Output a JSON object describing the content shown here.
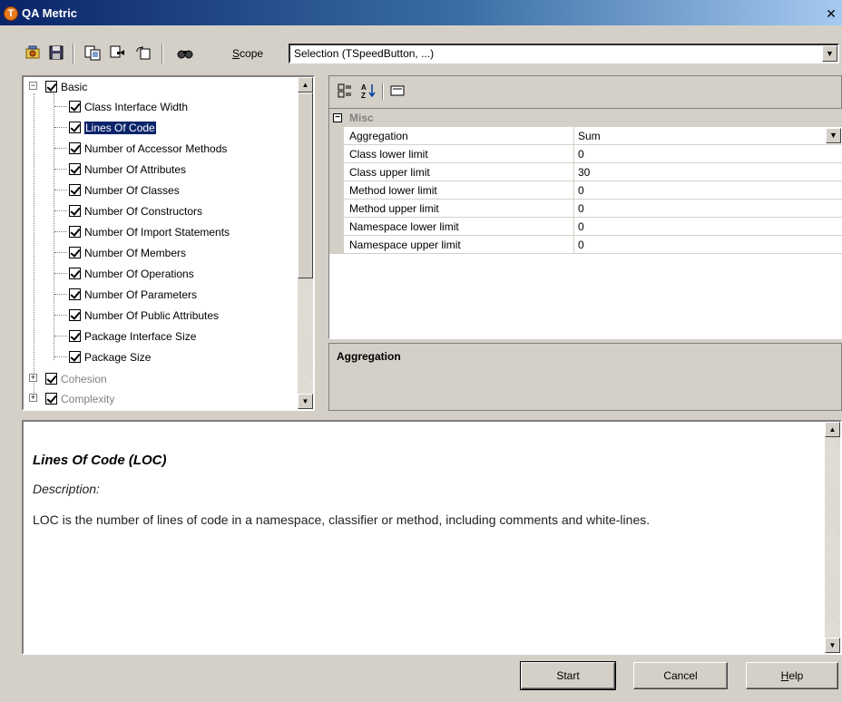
{
  "window": {
    "title": "QA Metric",
    "app_icon_glyph": "T",
    "close_glyph": "✕"
  },
  "toolbar": {
    "icons": [
      "settings-icon",
      "save-icon",
      "copy-metrics-icon",
      "paste-metrics-icon",
      "refresh-icon",
      "find-icon"
    ],
    "scope_label_accel": "S",
    "scope_label_rest": "cope",
    "scope_value": "Selection (TSpeedButton, ...)"
  },
  "tree": {
    "root": {
      "label": "Basic",
      "expander": "−"
    },
    "items": [
      {
        "label": "Class Interface Width"
      },
      {
        "label": "Lines Of Code",
        "selected": true
      },
      {
        "label": "Number of Accessor Methods"
      },
      {
        "label": "Number Of Attributes"
      },
      {
        "label": "Number Of Classes"
      },
      {
        "label": "Number Of Constructors"
      },
      {
        "label": "Number Of Import Statements"
      },
      {
        "label": "Number Of Members"
      },
      {
        "label": "Number Of Operations"
      },
      {
        "label": "Number Of Parameters"
      },
      {
        "label": "Number Of Public Attributes"
      },
      {
        "label": "Package Interface Size"
      },
      {
        "label": "Package Size"
      }
    ],
    "groups": [
      {
        "label": "Cohesion",
        "expander": "+"
      },
      {
        "label": "Complexity",
        "expander": "+"
      }
    ]
  },
  "properties": {
    "category": "Misc",
    "category_expander": "−",
    "rows": [
      {
        "name": "Aggregation",
        "value": "Sum",
        "combo": true
      },
      {
        "name": "Class lower limit",
        "value": "0"
      },
      {
        "name": "Class upper limit",
        "value": "30"
      },
      {
        "name": "Method lower limit",
        "value": "0"
      },
      {
        "name": "Method upper limit",
        "value": "0"
      },
      {
        "name": "Namespace lower limit",
        "value": "0"
      },
      {
        "name": "Namespace upper limit",
        "value": "0"
      }
    ],
    "help_title": "Aggregation"
  },
  "description": {
    "title": "Lines Of Code (LOC)",
    "label": "Description:",
    "text": "LOC is the number of lines of code in a namespace, classifier or method, including comments and white-lines."
  },
  "buttons": {
    "start": "Start",
    "cancel": "Cancel",
    "help_accel": "H",
    "help_rest": "elp"
  }
}
